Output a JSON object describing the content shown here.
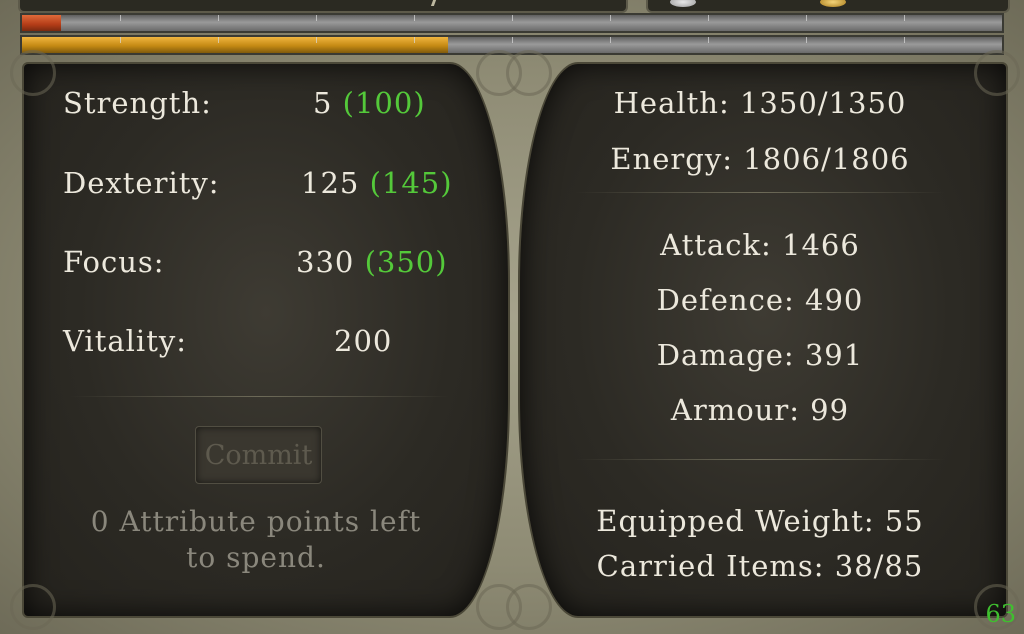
{
  "attributes": {
    "strength": {
      "label": "Strength:",
      "value": "5",
      "bonus": "(100)"
    },
    "dexterity": {
      "label": "Dexterity:",
      "value": "125",
      "bonus": "(145)"
    },
    "focus": {
      "label": "Focus:",
      "value": "330",
      "bonus": "(350)"
    },
    "vitality": {
      "label": "Vitality:",
      "value": "200"
    }
  },
  "commit_label": "Commit",
  "points_line1": "0 Attribute points left",
  "points_line2": "to spend.",
  "stats": {
    "health": "Health: 1350/1350",
    "energy": "Energy: 1806/1806",
    "attack": "Attack: 1466",
    "defence": "Defence: 490",
    "damage": "Damage: 391",
    "armour": "Armour: 99",
    "equipped_weight": "Equipped Weight: 55",
    "carried_items": "Carried Items: 38/85"
  },
  "bars": {
    "health_fill": 0.04,
    "xp_fill": 0.435,
    "health_color": "#b33c17",
    "xp_color": "#c58a14"
  },
  "page_number": "63",
  "icons": [
    "silver-coin-icon",
    "gold-coin-icon"
  ]
}
